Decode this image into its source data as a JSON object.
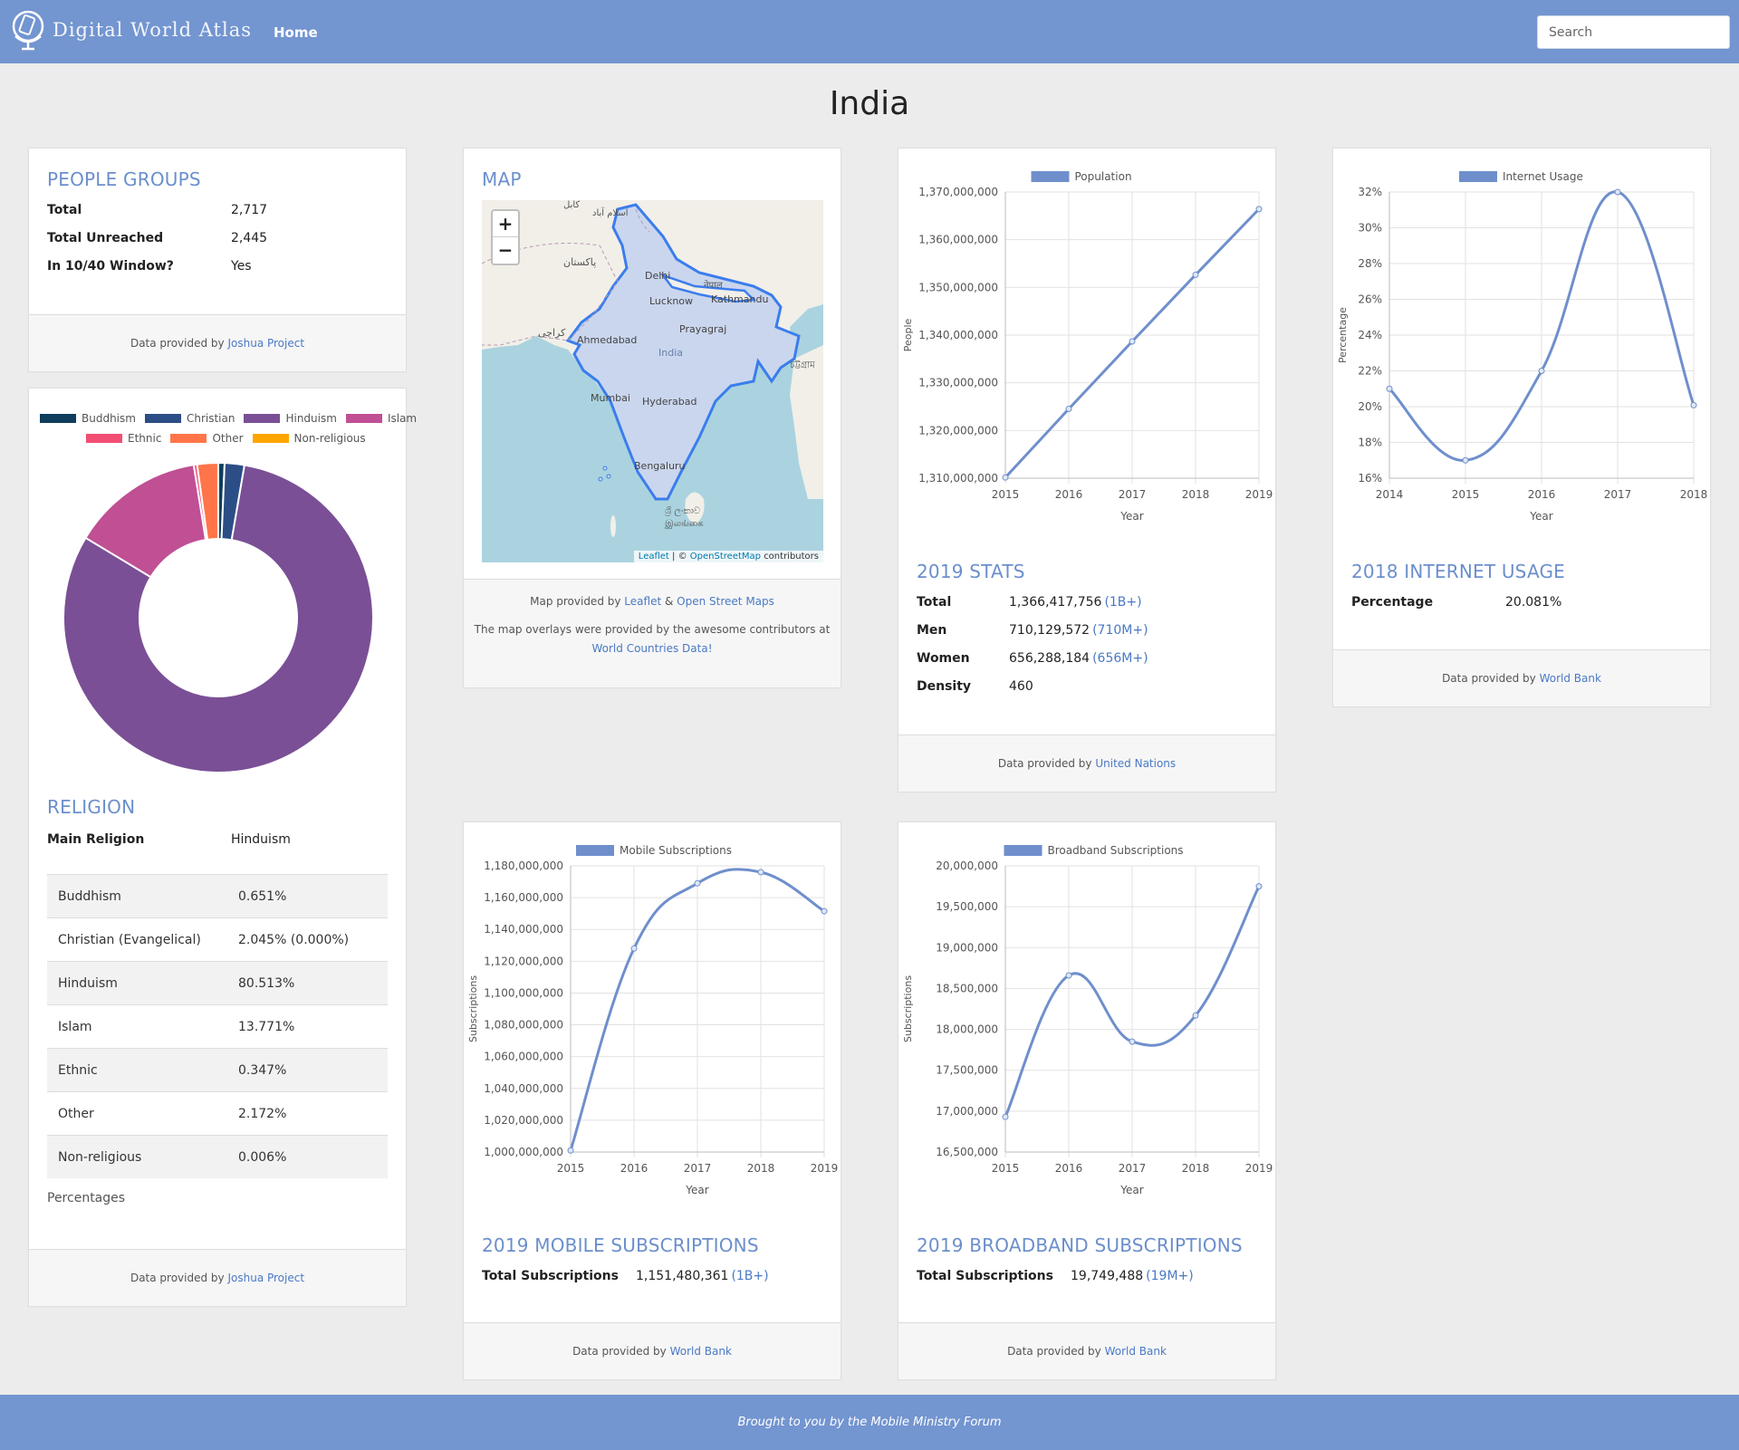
{
  "nav": {
    "brand": "Digital World Atlas",
    "home": "Home",
    "search_placeholder": "Search"
  },
  "page": {
    "title": "India"
  },
  "people_groups": {
    "title": "PEOPLE GROUPS",
    "rows": [
      {
        "label": "Total",
        "value": "2,717"
      },
      {
        "label": "Total Unreached",
        "value": "2,445"
      },
      {
        "label": "In 10/40 Window?",
        "value": "Yes"
      }
    ],
    "footer_prefix": "Data provided by",
    "footer_link": "Joshua Project"
  },
  "religion": {
    "title": "RELIGION",
    "main_label": "Main Religion",
    "main_value": "Hinduism",
    "rows": [
      {
        "name": "Buddhism",
        "pct": "0.651%"
      },
      {
        "name": "Christian (Evangelical)",
        "pct": "2.045% (0.000%)"
      },
      {
        "name": "Hinduism",
        "pct": "80.513%"
      },
      {
        "name": "Islam",
        "pct": "13.771%"
      },
      {
        "name": "Ethnic",
        "pct": "0.347%"
      },
      {
        "name": "Other",
        "pct": "2.172%"
      },
      {
        "name": "Non-religious",
        "pct": "0.006%"
      }
    ],
    "note": "Percentages",
    "footer_prefix": "Data provided by",
    "footer_link": "Joshua Project"
  },
  "map": {
    "title": "MAP",
    "zoom_in": "+",
    "zoom_out": "−",
    "labels": {
      "delhi": "Delhi",
      "lucknow": "Lucknow",
      "kathmandu": "Kathmandu",
      "ahmedabad": "Ahmedabad",
      "prayagraj": "Prayagraj",
      "india": "India",
      "mumbai": "Mumbai",
      "hyderabad": "Hyderabad",
      "bengaluru": "Bengaluru",
      "pakistan": "پاکستان",
      "karachi": "کراچی",
      "kabul": "کابل",
      "islamabad": "اسلام آباد",
      "nepal": "नेपाल",
      "chittagong": "চট্টগ্রাম",
      "srilanka1": "ශ්‍රී ලංකාව",
      "srilanka2": "இலங்கை"
    },
    "attrib_leaflet": "Leaflet",
    "attrib_sep": "| ©",
    "attrib_osm": "OpenStreetMap",
    "attrib_contrib": "contributors",
    "footer_line1_prefix": "Map provided by",
    "footer_link1": "Leaflet",
    "footer_amp": "&",
    "footer_link2": "Open Street Maps",
    "footer_line2": "The map overlays were provided by the awesome contributors at",
    "footer_link3": "World Countries Data!",
    "colors": {
      "water": "#aad3df",
      "land": "#f2efe9",
      "india": "#cad6ee",
      "border": "#3b7ded"
    }
  },
  "stats": {
    "title": "2019 STATS",
    "rows": [
      {
        "label": "Total",
        "value": "1,366,417,756",
        "abbr": "(1B+)"
      },
      {
        "label": "Men",
        "value": "710,129,572",
        "abbr": "(710M+)"
      },
      {
        "label": "Women",
        "value": "656,288,184",
        "abbr": "(656M+)"
      },
      {
        "label": "Density",
        "value": "460",
        "abbr": ""
      }
    ],
    "footer_prefix": "Data provided by",
    "footer_link": "United Nations"
  },
  "internet": {
    "title": "2018 INTERNET USAGE",
    "label": "Percentage",
    "value": "20.081%",
    "footer_prefix": "Data provided by",
    "footer_link": "World Bank"
  },
  "mobile": {
    "title": "2019 MOBILE SUBSCRIPTIONS",
    "label": "Total Subscriptions",
    "value": "1,151,480,361",
    "abbr": "(1B+)",
    "footer_prefix": "Data provided by",
    "footer_link": "World Bank"
  },
  "broadband": {
    "title": "2019 BROADBAND SUBSCRIPTIONS",
    "label": "Total Subscriptions",
    "value": "19,749,488",
    "abbr": "(19M+)",
    "footer_prefix": "Data provided by",
    "footer_link": "World Bank"
  },
  "footer": {
    "text": "Brought to you by the Mobile Ministry Forum"
  },
  "colors": {
    "nav": "#7395d0",
    "accent": "#6b8fcb",
    "line": "#6f8fcc"
  },
  "chart_data": [
    {
      "id": "religion",
      "type": "pie",
      "categories": [
        "Buddhism",
        "Christian",
        "Hinduism",
        "Islam",
        "Ethnic",
        "Other",
        "Non-religious"
      ],
      "values": [
        0.651,
        2.045,
        80.513,
        13.771,
        0.347,
        2.172,
        0.006
      ],
      "colors": [
        "#0f3d5c",
        "#2c4e86",
        "#7a4f96",
        "#c04f94",
        "#f24e73",
        "#ff7549",
        "#ffa600"
      ]
    },
    {
      "id": "population",
      "type": "line",
      "series": [
        {
          "name": "Population",
          "x": [
            "2015",
            "2016",
            "2017",
            "2018",
            "2019"
          ],
          "values": [
            1310152403,
            1324517249,
            1338676785,
            1352642280,
            1366417756
          ]
        }
      ],
      "xlabel": "Year",
      "ylabel": "People",
      "ylim": [
        1310000000,
        1370000000
      ],
      "yticks": [
        1310000000,
        1320000000,
        1330000000,
        1340000000,
        1350000000,
        1360000000,
        1370000000
      ],
      "yticklabels": [
        "1,310,000,000",
        "1,320,000,000",
        "1,330,000,000",
        "1,340,000,000",
        "1,350,000,000",
        "1,360,000,000",
        "1,370,000,000"
      ]
    },
    {
      "id": "internet",
      "type": "line",
      "series": [
        {
          "name": "Internet Usage",
          "x": [
            "2014",
            "2015",
            "2016",
            "2017",
            "2018"
          ],
          "values": [
            21.0,
            17.0,
            22.0,
            32.0,
            20.081
          ]
        }
      ],
      "xlabel": "Year",
      "ylabel": "Percentage",
      "ylim": [
        16,
        32
      ],
      "yticks": [
        16,
        18,
        20,
        22,
        24,
        26,
        28,
        30,
        32
      ],
      "yticklabels": [
        "16%",
        "18%",
        "20%",
        "22%",
        "24%",
        "26%",
        "28%",
        "30%",
        "32%"
      ]
    },
    {
      "id": "mobile",
      "type": "line",
      "series": [
        {
          "name": "Mobile Subscriptions",
          "x": [
            "2015",
            "2016",
            "2017",
            "2018",
            "2019"
          ],
          "values": [
            1001000000,
            1128000000,
            1169000000,
            1176000000,
            1151480361
          ]
        }
      ],
      "xlabel": "Year",
      "ylabel": "Subscriptions",
      "ylim": [
        1000000000,
        1180000000
      ],
      "yticks": [
        1000000000,
        1020000000,
        1040000000,
        1060000000,
        1080000000,
        1100000000,
        1120000000,
        1140000000,
        1160000000,
        1180000000
      ],
      "yticklabels": [
        "1,000,000,000",
        "1,020,000,000",
        "1,040,000,000",
        "1,060,000,000",
        "1,080,000,000",
        "1,100,000,000",
        "1,120,000,000",
        "1,140,000,000",
        "1,160,000,000",
        "1,180,000,000"
      ]
    },
    {
      "id": "broadband",
      "type": "line",
      "series": [
        {
          "name": "Broadband Subscriptions",
          "x": [
            "2015",
            "2016",
            "2017",
            "2018",
            "2019"
          ],
          "values": [
            16930000,
            18660000,
            17850000,
            18170000,
            19749488
          ]
        }
      ],
      "xlabel": "Year",
      "ylabel": "Subscriptions",
      "ylim": [
        16500000,
        20000000
      ],
      "yticks": [
        16500000,
        17000000,
        17500000,
        18000000,
        18500000,
        19000000,
        19500000,
        20000000
      ],
      "yticklabels": [
        "16,500,000",
        "17,000,000",
        "17,500,000",
        "18,000,000",
        "18,500,000",
        "19,000,000",
        "19,500,000",
        "20,000,000"
      ]
    }
  ]
}
